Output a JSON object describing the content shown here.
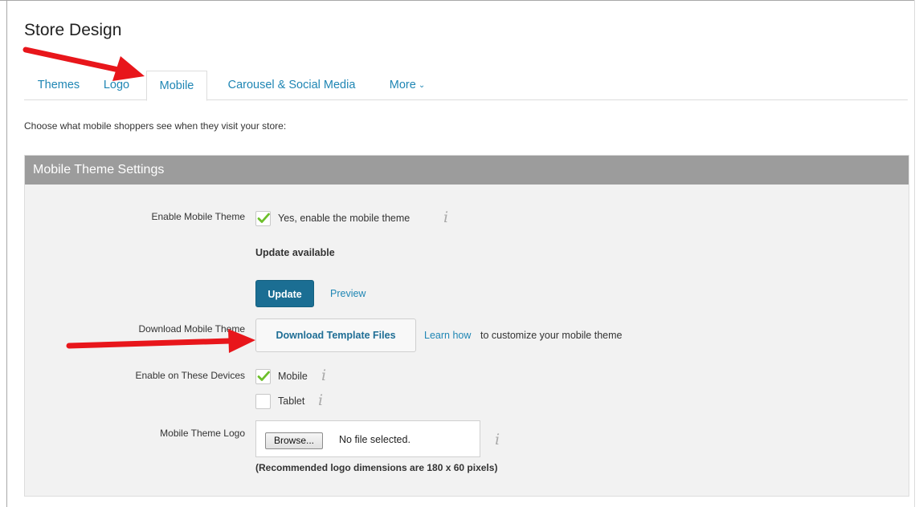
{
  "page": {
    "title": "Store Design"
  },
  "tabs": [
    {
      "label": "Themes",
      "active": false
    },
    {
      "label": "Logo",
      "active": false
    },
    {
      "label": "Mobile",
      "active": true
    },
    {
      "label": "Carousel & Social Media",
      "active": false
    },
    {
      "label": "More",
      "active": false
    }
  ],
  "intro": "Choose what mobile shoppers see when they visit your store:",
  "panel": {
    "title": "Mobile Theme Settings",
    "enable_theme": {
      "label": "Enable Mobile Theme",
      "checkbox_label": "Yes, enable the mobile theme",
      "checked": true
    },
    "update_status": "Update available",
    "update_button": "Update",
    "preview_link": "Preview",
    "download": {
      "label": "Download Mobile Theme",
      "button": "Download Template Files",
      "learn_link": "Learn how",
      "learn_text": "to customize your mobile theme"
    },
    "devices": {
      "label": "Enable on These Devices",
      "mobile": {
        "label": "Mobile",
        "checked": true
      },
      "tablet": {
        "label": "Tablet",
        "checked": false
      }
    },
    "logo": {
      "label": "Mobile Theme Logo",
      "browse_button": "Browse...",
      "file_status": "No file selected.",
      "hint": "(Recommended logo dimensions are 180 x 60 pixels)"
    }
  },
  "colors": {
    "link": "#1f86b4",
    "panel_header": "#9c9c9c",
    "primary_button": "#1b6e93",
    "check": "#6cbf2a",
    "annotation_arrow": "#e8161b"
  },
  "icons": {
    "info": "info-italic-i-icon",
    "check": "checkmark-icon",
    "more": "chevron-down-icon"
  }
}
